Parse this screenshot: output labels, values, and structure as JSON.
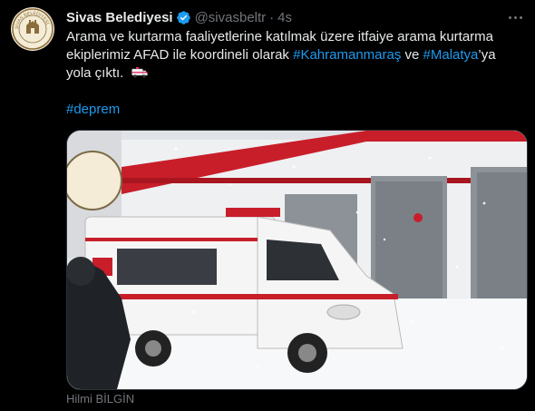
{
  "tweet": {
    "account_name": "Sivas Belediyesi",
    "handle": "@sivasbeltr",
    "separator": "·",
    "time": "4s",
    "text_part1": "Arama ve kurtarma faaliyetlerine katılmak üzere itfaiye arama kurtarma ekiplerimiz AFAD ile koordineli olarak ",
    "hashtag1": "#Kahramanmaraş",
    "text_part2": " ve ",
    "hashtag2": "#Malatya",
    "text_part3": "’ya yola çıktı.",
    "hashtag3": "#deprem",
    "emoji": "ambulance-emoji",
    "avatar_text": "SİVAS BELEDİYESİ",
    "media_credit": "Hilmi BİLGİN"
  },
  "colors": {
    "background": "#000000",
    "text": "#e7e9ea",
    "secondary": "#71767b",
    "link": "#1d9bf0",
    "verified": "#1d9bf0"
  },
  "icons": [
    "verified-badge-icon",
    "more-options-icon",
    "ambulance-emoji"
  ]
}
